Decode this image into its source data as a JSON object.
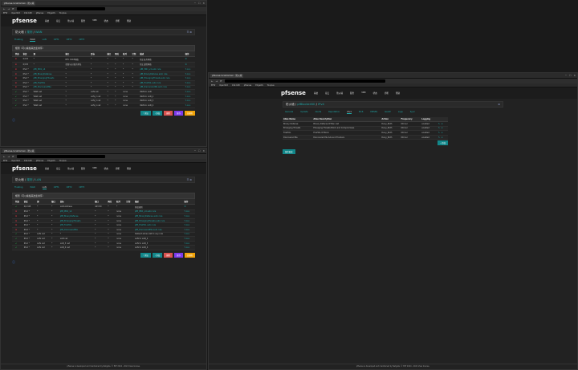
{
  "win_a": {
    "tab_title": "pfSense.localdomain - 防火墙",
    "bookmarks": [
      "EFW",
      "OpenWrt",
      "192.168",
      "pfSense",
      "EdgeOS",
      "Tooplus"
    ],
    "nav_brand": "pfsense",
    "nav_items": [
      "系统",
      "接口",
      "防火墙",
      "服务",
      "VPN",
      "状态",
      "诊断",
      "帮助"
    ],
    "breadcrumb": [
      "防火墙",
      "规则",
      "WAN"
    ],
    "tabs": [
      "Floating",
      "WAN",
      "LAN",
      "OPT1",
      "OPT2",
      "OPT3"
    ],
    "active_tab": "WAN",
    "panel_title": "规则（可以拖拽来改变排序）",
    "headers": [
      "",
      "状态",
      "协议",
      "源",
      "端口",
      "目标",
      "端口",
      "网关",
      "队列",
      "计划",
      "描述",
      "操作"
    ],
    "rows": [
      [
        "",
        "✖",
        "0/0 B",
        "*",
        "RFC 1918网络",
        "*",
        "*",
        "*",
        "*",
        "*",
        "阻止私有网络",
        "⚙"
      ],
      [
        "",
        "✖",
        "0/0 B",
        "*",
        "保留/未分配的地址",
        "*",
        "*",
        "*",
        "*",
        "*",
        "阻止虚假网络",
        "⚙"
      ],
      [
        "",
        "✖",
        "IPv4 *",
        "pfB_PRI1_v4",
        "*",
        "*",
        "*",
        "*",
        "*",
        "*",
        "pfB_PRI1_v4 auto rule",
        "✎⧉⊘"
      ],
      [
        "",
        "✖",
        "IPv4 *",
        "pfB_BinaryDefense",
        "*",
        "*",
        "*",
        "*",
        "*",
        "*",
        "pfB_BinaryDefense auto rule",
        "✎⧉⊘"
      ],
      [
        "",
        "✖",
        "IPv4 *",
        "pfB_EmergingThreats",
        "*",
        "*",
        "*",
        "*",
        "*",
        "*",
        "pfB_EmergingThreats auto rule",
        "✎⧉⊘"
      ],
      [
        "",
        "✖",
        "IPv4 *",
        "pfB_FireHOL",
        "*",
        "*",
        "*",
        "*",
        "*",
        "*",
        "pfB_FireHOL auto rule",
        "✎⧉⊘"
      ],
      [
        "",
        "✖",
        "IPv4 *",
        "pfB_DiscoveredMe",
        "*",
        "*",
        "*",
        "*",
        "*",
        "*",
        "pfB_DiscoveredMe auto rule",
        "✎⧉⊘"
      ],
      [
        "",
        "✔",
        "IPv4 *",
        "WAN net",
        "*",
        "LAN net",
        "*",
        "*",
        "none",
        "",
        "WAN to LAN",
        "✎⧉⊘"
      ],
      [
        "",
        "✔",
        "IPv4 *",
        "WAN net",
        "*",
        "LAN_2 net",
        "*",
        "*",
        "none",
        "",
        "WAN to LAN_2",
        "✎⧉⊘"
      ],
      [
        "",
        "✔",
        "IPv4 *",
        "WAN net",
        "*",
        "LAN_3 net",
        "*",
        "*",
        "none",
        "",
        "WAN to LAN_3",
        "✎⧉⊘"
      ],
      [
        "",
        "✔",
        "IPv4 *",
        "WAN net",
        "*",
        "LAN_4 net",
        "*",
        "*",
        "none",
        "",
        "WAN to LAN_4",
        "✎⧉⊘"
      ]
    ],
    "buttons": [
      "↑ 添加",
      "↓ 添加",
      "删除",
      "保存",
      "分隔符"
    ]
  },
  "win_b": {
    "tab_title": "pfSense.localdomain - 防火墙",
    "bookmarks": [
      "EFW",
      "OpenWrt",
      "192.168",
      "pfSense",
      "EdgeOS",
      "Tooplus"
    ],
    "nav_brand": "pfsense",
    "nav_items": [
      "系统",
      "接口",
      "防火墙",
      "服务",
      "VPN",
      "状态",
      "诊断",
      "帮助"
    ],
    "breadcrumb": [
      "防火墙",
      "规则",
      "LAN"
    ],
    "tabs": [
      "Floating",
      "WAN",
      "LAN",
      "OPT1",
      "OPT2",
      "OPT3"
    ],
    "active_tab": "LAN",
    "panel_title": "规则（可以拖拽来改变排序）",
    "headers": [
      "",
      "状态",
      "协议",
      "源",
      "端口",
      "目标",
      "端口",
      "网关",
      "队列",
      "计划",
      "描述",
      "操作"
    ],
    "rows": [
      [
        "",
        "✔",
        "0/2 KiB",
        "*",
        "*",
        "LAN Address",
        "443 80",
        "*",
        "*",
        "",
        "防锁规则",
        "⚙"
      ],
      [
        "",
        "✖",
        "IPv4 *",
        "*",
        "*",
        "pfB_PRI1_v4",
        "*",
        "*",
        "none",
        "",
        "pfB_PRI1_v4 auto rule",
        "✎⧉⊘"
      ],
      [
        "",
        "✖",
        "IPv4 *",
        "*",
        "*",
        "pfB_BinaryDefense",
        "*",
        "*",
        "none",
        "",
        "pfB_BinaryDefense auto rule",
        "✎⧉⊘"
      ],
      [
        "",
        "✖",
        "IPv4 *",
        "*",
        "*",
        "pfB_EmergingThreats",
        "*",
        "*",
        "none",
        "",
        "pfB_EmergingThreats auto rule",
        "✎⧉⊘"
      ],
      [
        "",
        "✖",
        "IPv4 *",
        "*",
        "*",
        "pfB_FireHOL",
        "*",
        "*",
        "none",
        "",
        "pfB_FireHOL auto rule",
        "✎⧉⊘"
      ],
      [
        "",
        "✖",
        "IPv4 *",
        "*",
        "*",
        "pfB_DiscoveredMe",
        "*",
        "*",
        "none",
        "",
        "pfB_DiscoveredMe auto rule",
        "✎⧉⊘"
      ],
      [
        "",
        "✔",
        "IPv4 *",
        "LAN net",
        "*",
        "*",
        "*",
        "*",
        "none",
        "",
        "Default allow LAN to any rule",
        "✎⧉⊘"
      ],
      [
        "",
        "✔",
        "IPv4 *",
        "LAN net",
        "*",
        "LAN net",
        "*",
        "*",
        "none",
        "",
        "LAN to LAN_2",
        "✎⧉⊘"
      ],
      [
        "",
        "✔",
        "IPv4 *",
        "LAN net",
        "*",
        "LAN_3 net",
        "*",
        "*",
        "none",
        "",
        "LAN to LAN_3",
        "✎⧉⊘"
      ],
      [
        "",
        "✔",
        "IPv4 *",
        "LAN net",
        "*",
        "LAN_4 net",
        "*",
        "*",
        "none",
        "",
        "LAN to LAN_4",
        "✎⧉⊘"
      ]
    ],
    "buttons": [
      "↑ 添加",
      "↓ 添加",
      "删除",
      "保存",
      "分隔符"
    ],
    "footer": "pfSense is developed and maintained by Netgate. © ESF 2004 - 2021 View license."
  },
  "win_c": {
    "tab_title": "pfSense.localdomain - 防火墙",
    "bookmarks": [
      "EFW",
      "OpenWrt",
      "192.168",
      "pfSense",
      "EdgeOS",
      "Tooplus"
    ],
    "nav_brand": "pfsense",
    "nav_items": [
      "系统",
      "接口",
      "防火墙",
      "服务",
      "VPN",
      "状态",
      "诊断",
      "帮助"
    ],
    "breadcrumb": [
      "防火墙",
      "pfBlockerNG",
      "IPv4"
    ],
    "tabs": [
      "General",
      "Update",
      "Alerts",
      "Reputation",
      "IPv4",
      "IPv6",
      "DNSBL",
      "GeoIP",
      "Logs",
      "Sync"
    ],
    "active_tab": "IPv4",
    "headers": [
      "Alias Name",
      "Alias Description",
      "Action",
      "Frequency",
      "Logging",
      ""
    ],
    "rows": [
      [
        "Binary Defense",
        "Binary Defense IP Ban List",
        "Deny_Both",
        "01hour",
        "enabled",
        "✎ ⊘"
      ],
      [
        "Emerging Threats",
        "Emerging Threats Block and Compromises",
        "Deny_Both",
        "01hour",
        "enabled",
        "✎ ⊘"
      ],
      [
        "FireHOL",
        "FireHOL IP Block",
        "Deny_Both",
        "01hour",
        "enabled",
        "✎ ⊘"
      ],
      [
        "Discovered Me",
        "Discovered Me Ads and Trackers",
        "Deny_Both",
        "01hour",
        "enabled",
        "✎ ⊘"
      ]
    ],
    "add_button": "+ 添加",
    "save_button": "保存更改",
    "footer": "pfSense is developed and maintained by Netgate. © ESF 2004 - 2021 View license."
  }
}
